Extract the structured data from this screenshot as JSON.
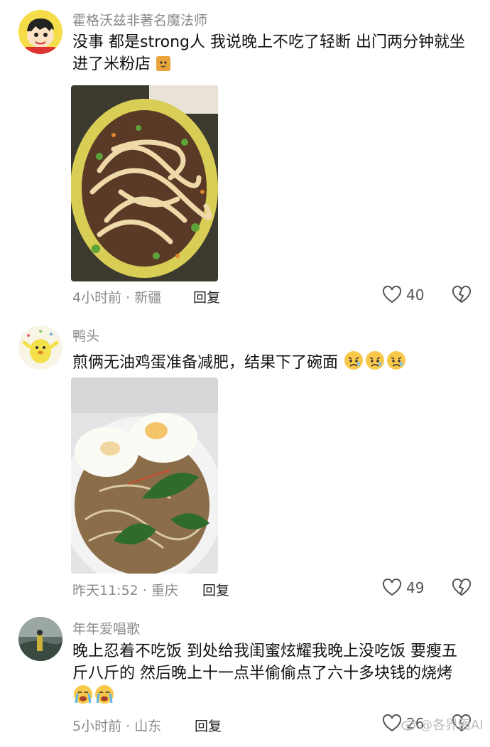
{
  "comments": [
    {
      "username": "霍格沃兹非著名魔法师",
      "text": "没事 都是strong人 我说晚上不吃了轻断 出门两分钟就坐进了米粉店",
      "meta": "4小时前 · 新疆",
      "reply_label": "回复",
      "likes": "40",
      "photo_icon": "rice-noodle-bowl-photo"
    },
    {
      "username": "鸭头",
      "text": "煎俩无油鸡蛋准备减肥，结果下了碗面",
      "meta": "昨天11:52 · 重庆",
      "reply_label": "回复",
      "likes": "49",
      "photo_icon": "egg-noodle-bowl-photo"
    },
    {
      "username": "年年爱唱歌",
      "text": "晚上忍着不吃饭 到处给我闺蜜炫耀我晚上没吃饭 要瘦五斤八斤的 然后晚上十一点半偷偷点了六十多块钱的烧烤",
      "meta": "5小时前 · 山东",
      "reply_label": "回复",
      "likes": "26"
    }
  ],
  "watermark": "@各界面AI"
}
